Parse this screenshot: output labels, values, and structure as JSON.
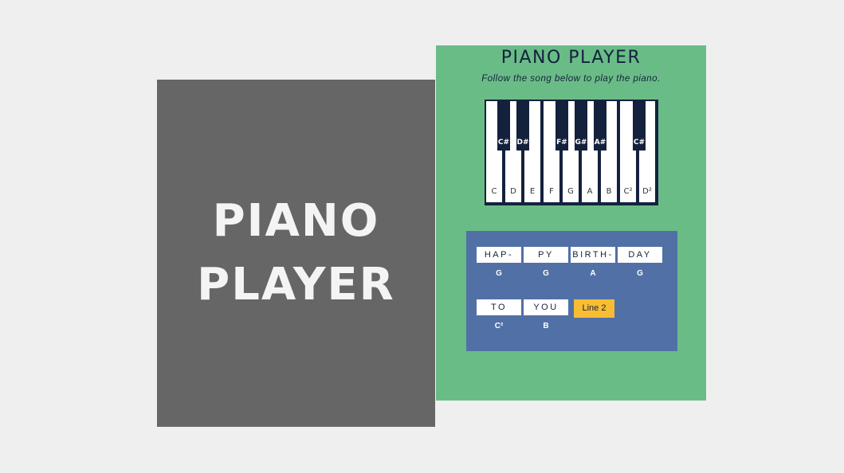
{
  "cover": {
    "title": "PIANO PLAYER"
  },
  "panel": {
    "title": "PIANO PLAYER",
    "subtitle": "Follow the song below to play the piano."
  },
  "piano": {
    "white_keys": [
      "C",
      "D",
      "E",
      "F",
      "G",
      "A",
      "B",
      "C²",
      "D²"
    ],
    "black_keys": [
      "C#",
      "D#",
      "F#",
      "G#",
      "A#",
      "C#"
    ]
  },
  "song": {
    "line1": [
      {
        "word": "HAP-",
        "note": "G"
      },
      {
        "word": "PY",
        "note": "G"
      },
      {
        "word": "BIRTH-",
        "note": "A"
      },
      {
        "word": "DAY",
        "note": "G"
      }
    ],
    "line2": [
      {
        "word": "TO",
        "note": "C²"
      },
      {
        "word": "YOU",
        "note": "B"
      }
    ],
    "line_button": "Line 2"
  },
  "colors": {
    "page_bg": "#efefef",
    "cover_bg": "#666666",
    "panel_bg": "#6abc86",
    "song_bg": "#5170a6",
    "navy": "#14213d",
    "accent": "#f8bd32"
  }
}
